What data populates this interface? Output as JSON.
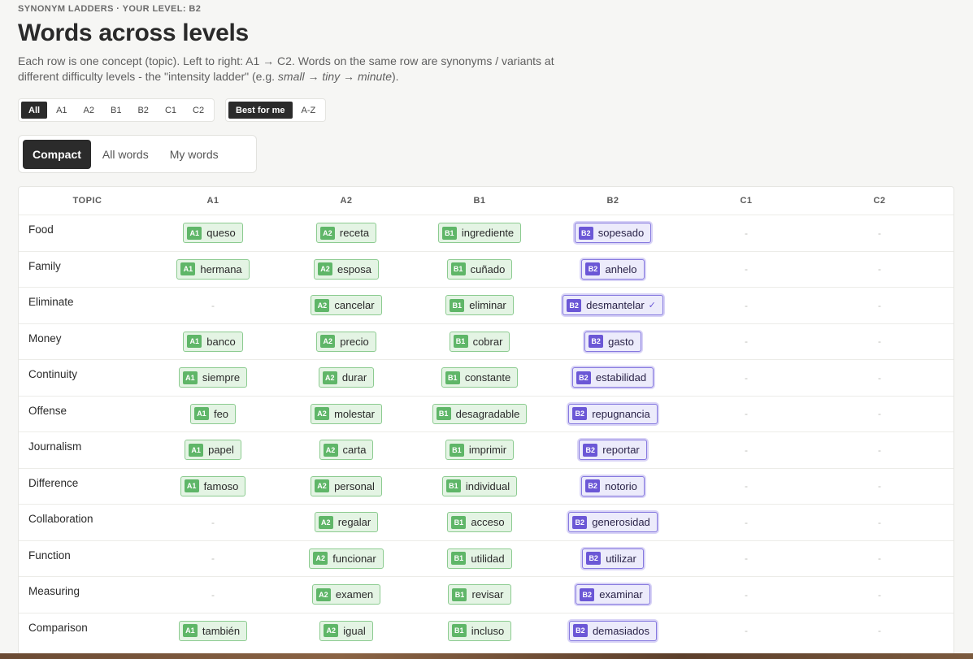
{
  "header": {
    "eyebrow": "SYNONYM LADDERS · YOUR LEVEL: B2",
    "title": "Words across levels",
    "desc_pre": "Each row is one concept (topic). Left to right: A1 → C2. Words on the same row are synonyms / variants at different difficulty levels - the \"intensity ladder\" (e.g. ",
    "ex1": "small",
    "arrow": " → ",
    "ex2": "tiny",
    "ex3": "minute",
    "desc_post": ")."
  },
  "filters": {
    "levels": [
      "All",
      "A1",
      "A2",
      "B1",
      "B2",
      "C1",
      "C2"
    ],
    "active_level": "All",
    "sort": [
      "Best for me",
      "A-Z"
    ],
    "active_sort": "Best for me"
  },
  "view_tabs": {
    "items": [
      "Compact",
      "All words",
      "My words"
    ],
    "active": "Compact"
  },
  "grid": {
    "columns": [
      "TOPIC",
      "A1",
      "A2",
      "B1",
      "B2",
      "C1",
      "C2"
    ],
    "empty": "-",
    "rows": [
      {
        "topic": "Food",
        "a1": "queso",
        "a2": "receta",
        "b1": "ingrediente",
        "b2": "sopesado",
        "c1": "",
        "c2": ""
      },
      {
        "topic": "Family",
        "a1": "hermana",
        "a2": "esposa",
        "b1": "cuñado",
        "b2": "anhelo",
        "c1": "",
        "c2": ""
      },
      {
        "topic": "Eliminate",
        "a1": "",
        "a2": "cancelar",
        "b1": "eliminar",
        "b2": "desmantelar",
        "b2_check": "✓",
        "c1": "",
        "c2": ""
      },
      {
        "topic": "Money",
        "a1": "banco",
        "a2": "precio",
        "b1": "cobrar",
        "b2": "gasto",
        "c1": "",
        "c2": ""
      },
      {
        "topic": "Continuity",
        "a1": "siempre",
        "a2": "durar",
        "b1": "constante",
        "b2": "estabilidad",
        "c1": "",
        "c2": ""
      },
      {
        "topic": "Offense",
        "a1": "feo",
        "a2": "molestar",
        "b1": "desagradable",
        "b2": "repugnancia",
        "c1": "",
        "c2": ""
      },
      {
        "topic": "Journalism",
        "a1": "papel",
        "a2": "carta",
        "b1": "imprimir",
        "b2": "reportar",
        "c1": "",
        "c2": ""
      },
      {
        "topic": "Difference",
        "a1": "famoso",
        "a2": "personal",
        "b1": "individual",
        "b2": "notorio",
        "c1": "",
        "c2": ""
      },
      {
        "topic": "Collaboration",
        "a1": "",
        "a2": "regalar",
        "b1": "acceso",
        "b2": "generosidad",
        "c1": "",
        "c2": ""
      },
      {
        "topic": "Function",
        "a1": "",
        "a2": "funcionar",
        "b1": "utilidad",
        "b2": "utilizar",
        "c1": "",
        "c2": ""
      },
      {
        "topic": "Measuring",
        "a1": "",
        "a2": "examen",
        "b1": "revisar",
        "b2": "examinar",
        "c1": "",
        "c2": ""
      },
      {
        "topic": "Comparison",
        "a1": "también",
        "a2": "igual",
        "b1": "incluso",
        "b2": "demasiados",
        "c1": "",
        "c2": ""
      }
    ]
  },
  "colors": {
    "green_chip": "#5fb668",
    "purple_chip": "#6b57d6",
    "active_dark": "#2b2b2b"
  }
}
